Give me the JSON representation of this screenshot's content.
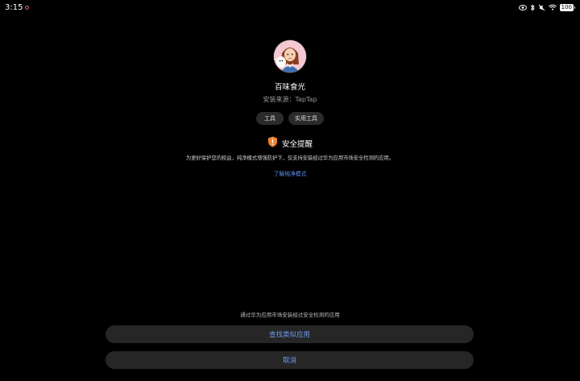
{
  "status_bar": {
    "time": "3:15",
    "battery": "100"
  },
  "app": {
    "name": "百味食光",
    "install_source": "安装来源：TapTap",
    "icon": "app-avatar-icon"
  },
  "tags": [
    "工具",
    "实用工具"
  ],
  "security": {
    "title": "安全提醒",
    "description": "为更好保护您的权益，纯净模式增强防护下，仅支持安装经过华为应用市场安全检测的应用。",
    "learn_more": "了解纯净模式",
    "icon": "shield-warning-icon",
    "icon_color": "#f0812e"
  },
  "footer": {
    "note": "通过华为应用市场安装经过安全检测的应用",
    "find_similar_label": "查找类似应用",
    "cancel_label": "取消"
  },
  "colors": {
    "accent": "#6f9af2",
    "background": "#000000",
    "button_bg": "#262626"
  }
}
